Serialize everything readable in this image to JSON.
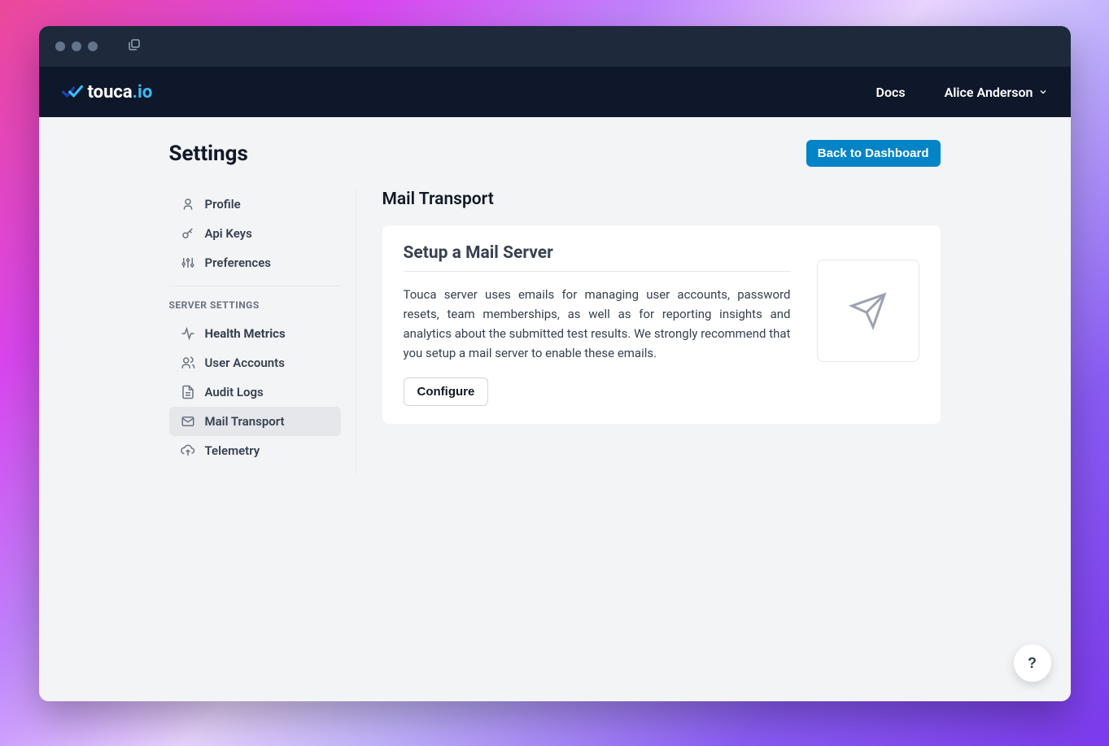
{
  "header": {
    "brand_name": "touca",
    "brand_suffix": ".io",
    "docs_label": "Docs",
    "user_name": "Alice Anderson"
  },
  "page": {
    "title": "Settings",
    "back_button": "Back to Dashboard"
  },
  "sidebar": {
    "personal": [
      {
        "label": "Profile",
        "icon": "user"
      },
      {
        "label": "Api Keys",
        "icon": "key"
      },
      {
        "label": "Preferences",
        "icon": "sliders"
      }
    ],
    "server_heading": "SERVER SETTINGS",
    "server": [
      {
        "label": "Health Metrics",
        "icon": "activity",
        "bold": true
      },
      {
        "label": "User Accounts",
        "icon": "users"
      },
      {
        "label": "Audit Logs",
        "icon": "file"
      },
      {
        "label": "Mail Transport",
        "icon": "mail",
        "active": true
      },
      {
        "label": "Telemetry",
        "icon": "cloud-upload"
      }
    ]
  },
  "main": {
    "section_title": "Mail Transport",
    "card_title": "Setup a Mail Server",
    "card_text": "Touca server uses emails for managing user accounts, password resets, team memberships, as well as for reporting insights and analytics about the submitted test results. We strongly recommend that you setup a mail server to enable these emails.",
    "configure_label": "Configure"
  },
  "help_label": "?"
}
